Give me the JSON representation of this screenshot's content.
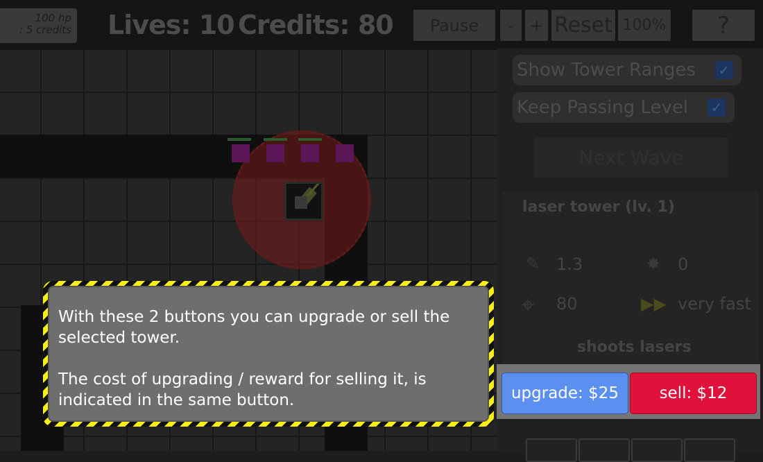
{
  "topbar": {
    "cost_line1": "100 hp",
    "cost_line2": ": 5 credits",
    "lives": "Lives: 10",
    "credits": "Credits: 80",
    "pause_label": "Pause",
    "speed_down_label": "-",
    "speed_up_label": "+",
    "reset_label": "Reset",
    "speed_value": "100%",
    "help_label": "?"
  },
  "options": {
    "show_ranges_label": "Show Tower Ranges",
    "show_ranges_checked": true,
    "keep_passing_label": "Keep Passing Level",
    "keep_passing_checked": true,
    "next_wave_label": "Next Wave"
  },
  "tower_info": {
    "title": "laser tower (lv. 1)",
    "damage": "1.3",
    "splash": "0",
    "range": "80",
    "speed": "very fast",
    "description": "shoots lasers"
  },
  "actions": {
    "upgrade_label": "upgrade: $25",
    "sell_label": "sell: $12"
  },
  "tutorial": {
    "para1": "With these 2 buttons you can upgrade or sell the selected tower.",
    "para2": "The cost of upgrading / reward for selling it, is indicated in the same button."
  },
  "colors": {
    "upgrade": "#5b8ff0",
    "sell": "#e0123b",
    "hazard_yellow": "#f7ef16"
  },
  "icons": [
    "damage-icon",
    "splash-icon",
    "range-crosshair-icon",
    "speed-arrows-icon",
    "laser-tower-icon"
  ]
}
